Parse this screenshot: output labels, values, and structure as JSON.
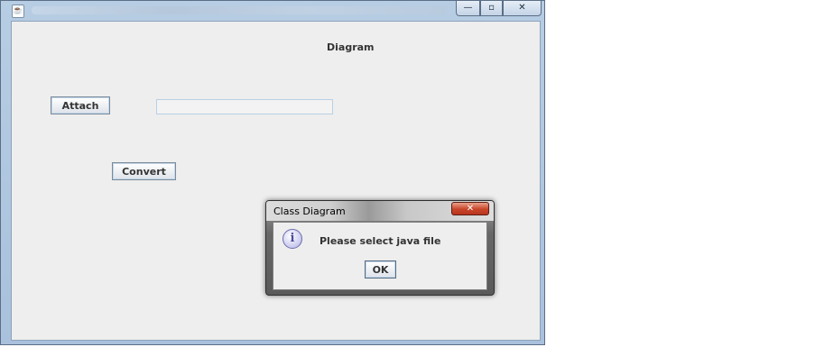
{
  "window": {
    "icon": "java-coffee-cup-icon",
    "min_glyph": "—",
    "max_glyph": "▫",
    "close_glyph": "✕"
  },
  "panel": {
    "title": "Diagram",
    "attach_label": "Attach",
    "file_path_value": "",
    "convert_label": "Convert"
  },
  "dialog": {
    "title": "Class Diagram",
    "close_glyph": "✕",
    "icon": "information-icon",
    "icon_glyph": "i",
    "message": "Please select java file",
    "ok_label": "OK"
  }
}
